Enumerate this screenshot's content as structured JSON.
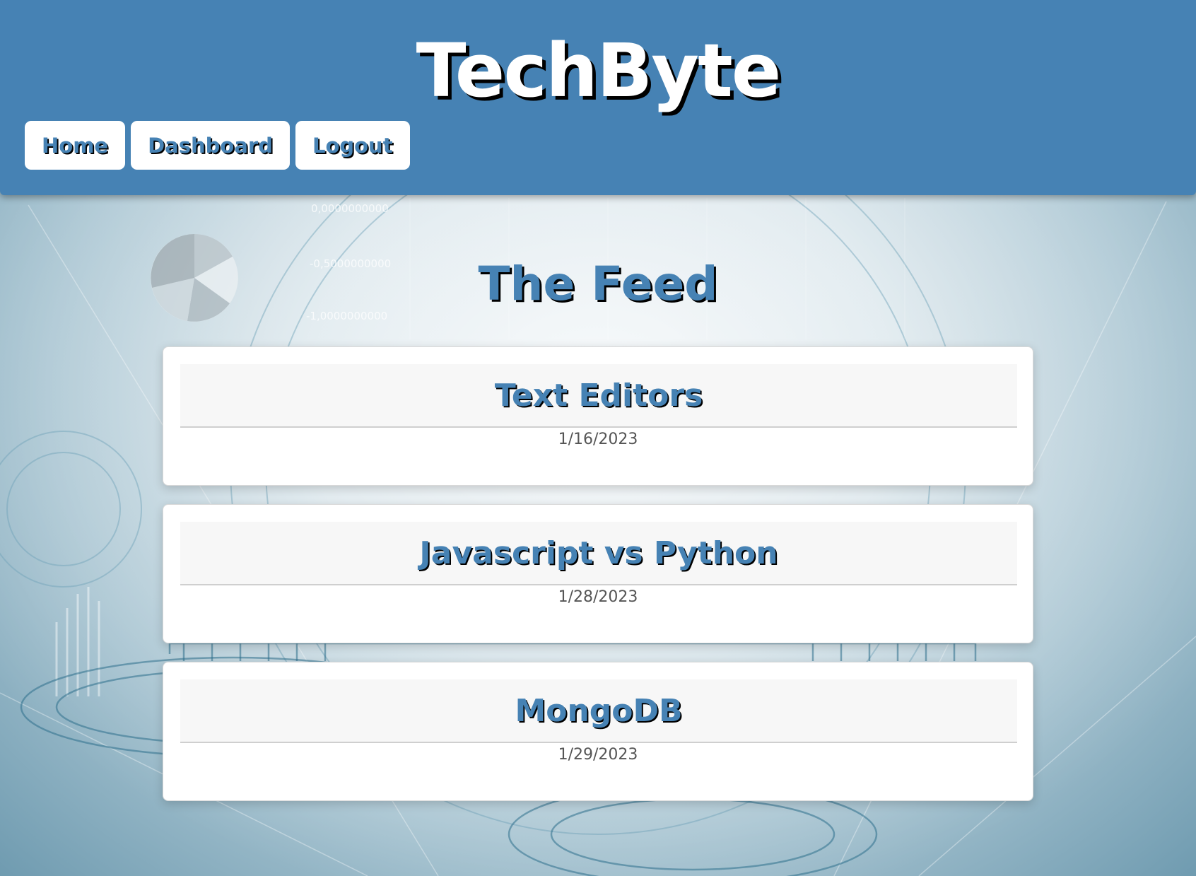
{
  "site": {
    "title": "TechByte",
    "accent_color": "#4682b4"
  },
  "nav": {
    "items": [
      {
        "label": "Home"
      },
      {
        "label": "Dashboard"
      },
      {
        "label": "Logout"
      }
    ]
  },
  "feed": {
    "heading": "The Feed",
    "posts": [
      {
        "title": "Text Editors",
        "date": "1/16/2023"
      },
      {
        "title": "Javascript vs Python",
        "date": "1/28/2023"
      },
      {
        "title": "MongoDB",
        "date": "1/29/2023"
      }
    ]
  },
  "background": {
    "decorative_numbers": [
      "0,0000000000",
      "-0,5000000000",
      "-1,0000000000"
    ]
  }
}
